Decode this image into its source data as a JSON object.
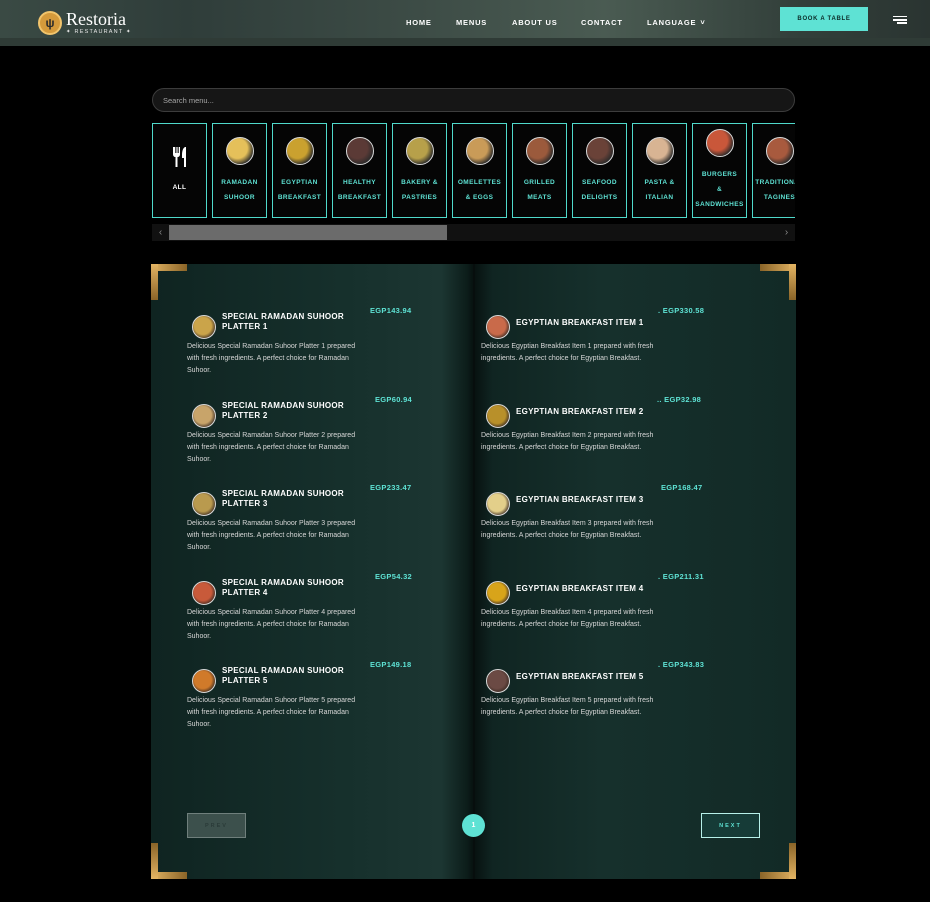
{
  "brand": {
    "name": "Restoria",
    "subtitle": "✦ RESTAURANT ✦"
  },
  "nav": [
    {
      "label": "HOME"
    },
    {
      "label": "MENUS"
    },
    {
      "label": "ABOUT US"
    },
    {
      "label": "CONTACT"
    },
    {
      "label": "LANGUAGE"
    }
  ],
  "header": {
    "book_label": "BOOK A TABLE"
  },
  "search": {
    "placeholder": "Search menu..."
  },
  "categories": [
    {
      "label": "ALL",
      "icon": "fork-knife-icon"
    },
    {
      "label": "RAMADAN\nSUHOOR",
      "color": "#e5c05a"
    },
    {
      "label": "EGYPTIAN\nBREAKFAST",
      "color": "#caa12f"
    },
    {
      "label": "HEALTHY\nBREAKFAST",
      "color": "#5b3a36"
    },
    {
      "label": "BAKERY &\nPASTRIES",
      "color": "#b7a04a"
    },
    {
      "label": "OMELETTES\n& EGGS",
      "color": "#c99b58"
    },
    {
      "label": "GRILLED\nMEATS",
      "color": "#9b5a3c"
    },
    {
      "label": "SEAFOOD\nDELIGHTS",
      "color": "#6a4238"
    },
    {
      "label": "PASTA &\nITALIAN",
      "color": "#d8b493"
    },
    {
      "label": "BURGERS\n&\nSANDWICHES",
      "color": "#c9573a"
    },
    {
      "label": "TRADITIONAL\nTAGINES",
      "color": "#a85a3e"
    }
  ],
  "left_page": [
    {
      "title": "SPECIAL RAMADAN SUHOOR PLATTER 1",
      "price": "EGP143.94",
      "desc": "Delicious Special Ramadan Suhoor Platter 1 prepared with fresh ingredients. A perfect choice for Ramadan Suhoor.",
      "color": "#caa44a"
    },
    {
      "title": "SPECIAL RAMADAN SUHOOR PLATTER 2",
      "price": "EGP60.94",
      "desc": "Delicious Special Ramadan Suhoor Platter 2 prepared with fresh ingredients. A perfect choice for Ramadan Suhoor.",
      "color": "#c8a46a"
    },
    {
      "title": "SPECIAL RAMADAN SUHOOR PLATTER 3",
      "price": "EGP233.47",
      "desc": "Delicious Special Ramadan Suhoor Platter 3 prepared with fresh ingredients. A perfect choice for Ramadan Suhoor.",
      "color": "#b99a4e"
    },
    {
      "title": "SPECIAL RAMADAN SUHOOR PLATTER 4",
      "price": "EGP54.32",
      "desc": "Delicious Special Ramadan Suhoor Platter 4 prepared with fresh ingredients. A perfect choice for Ramadan Suhoor.",
      "color": "#c85a3a"
    },
    {
      "title": "SPECIAL RAMADAN SUHOOR PLATTER 5",
      "price": "EGP149.18",
      "desc": "Delicious Special Ramadan Suhoor Platter 5 prepared with fresh ingredients. A perfect choice for Ramadan Suhoor.",
      "color": "#d07a2a"
    }
  ],
  "right_page": [
    {
      "title": "EGYPTIAN BREAKFAST ITEM 1",
      "price": ". EGP330.58",
      "desc": "Delicious Egyptian Breakfast Item 1 prepared with fresh ingredients. A perfect choice for Egyptian Breakfast.",
      "color": "#c96a4a"
    },
    {
      "title": "EGYPTIAN BREAKFAST ITEM 2",
      "price": ".. EGP32.98",
      "desc": "Delicious Egyptian Breakfast Item 2 prepared with fresh ingredients. A perfect choice for Egyptian Breakfast.",
      "color": "#b8902a"
    },
    {
      "title": "EGYPTIAN BREAKFAST ITEM 3",
      "price": "EGP168.47",
      "desc": "Delicious Egyptian Breakfast Item 3 prepared with fresh ingredients. A perfect choice for Egyptian Breakfast.",
      "color": "#e3cf8a"
    },
    {
      "title": "EGYPTIAN BREAKFAST ITEM 4",
      "price": ". EGP211.31",
      "desc": "Delicious Egyptian Breakfast Item 4 prepared with fresh ingredients. A perfect choice for Egyptian Breakfast.",
      "color": "#d8a41a"
    },
    {
      "title": "EGYPTIAN BREAKFAST ITEM 5",
      "price": ". EGP343.83",
      "desc": "Delicious Egyptian Breakfast Item 5 prepared with fresh ingredients. A perfect choice for Egyptian Breakfast.",
      "color": "#6b4a44"
    }
  ],
  "pagination": {
    "prev": "PREV",
    "next": "NEXT",
    "current": "1"
  },
  "colors": {
    "accent": "#5ee2d4",
    "gold": "#d59a3b",
    "page": "#16302c"
  }
}
